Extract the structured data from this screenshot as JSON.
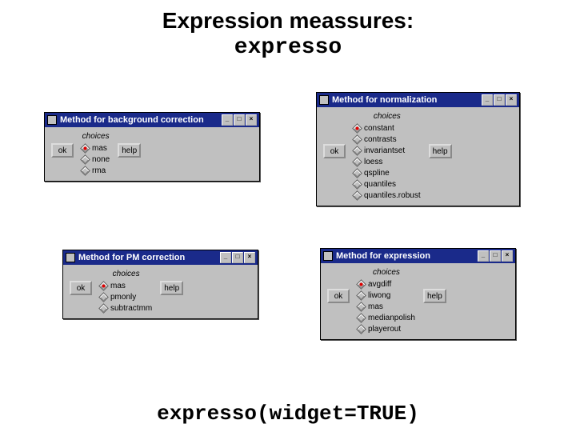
{
  "heading": {
    "line1": "Expression meassures:",
    "line2": "expresso"
  },
  "footer_code": "expresso(widget=TRUE)",
  "common": {
    "choices_label": "choices",
    "ok_label": "ok",
    "help_label": "help",
    "min_icon": "_",
    "max_icon": "□",
    "close_icon": "×"
  },
  "dialogs": {
    "bg": {
      "title": "Method for background correction",
      "options": [
        "mas",
        "none",
        "rma"
      ],
      "selected": "mas"
    },
    "norm": {
      "title": "Method for normalization",
      "options": [
        "constant",
        "contrasts",
        "invariantset",
        "loess",
        "qspline",
        "quantiles",
        "quantiles.robust"
      ],
      "selected": "constant"
    },
    "pm": {
      "title": "Method for PM correction",
      "options": [
        "mas",
        "pmonly",
        "subtractmm"
      ],
      "selected": "mas"
    },
    "expr": {
      "title": "Method for expression",
      "options": [
        "avgdiff",
        "liwong",
        "mas",
        "medianpolish",
        "playerout"
      ],
      "selected": "avgdiff"
    }
  }
}
